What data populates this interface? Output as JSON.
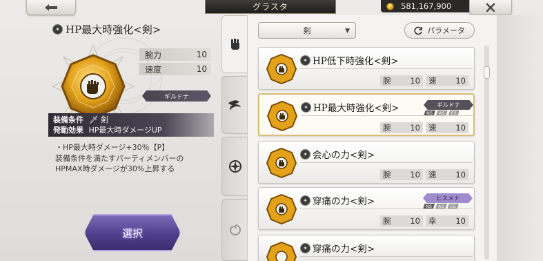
{
  "header": {
    "title": "グラスタ",
    "currency_value": "581,167,900"
  },
  "detail": {
    "title": "HP最大時強化<剣>",
    "stats": [
      {
        "label": "腕力",
        "value": "10"
      },
      {
        "label": "速度",
        "value": "10"
      }
    ],
    "job_tag": "ギルドナ",
    "equip_condition_label": "装備条件",
    "equip_condition_value": "剣",
    "effect_label": "発動効果",
    "effect_value": "HP最大時ダメージUP",
    "description_lines": [
      "・HP最大時ダメージ+30％【P】",
      "装備条件を満たすパーティメンバーの",
      "HPMAX時ダメージが30%上昇する"
    ],
    "select_label": "選択"
  },
  "filter": {
    "dropdown_value": "剣",
    "param_label": "パラメータ"
  },
  "tabs": [
    {
      "icon": "fist-icon",
      "active": true
    },
    {
      "icon": "swirl-icon",
      "active": false
    },
    {
      "icon": "compass-star-icon",
      "active": false
    },
    {
      "icon": "spiral-icon",
      "active": false
    }
  ],
  "list": [
    {
      "name": "HP低下時強化<剣>",
      "stat1_label": "腕",
      "stat1_value": "10",
      "stat2_label": "速",
      "stat2_value": "10",
      "job": "",
      "badges": []
    },
    {
      "name": "HP最大時強化<剣>",
      "stat1_label": "腕",
      "stat1_value": "10",
      "stat2_label": "速",
      "stat2_value": "10",
      "job": "ギルドナ",
      "badges": [
        "NS",
        "AS",
        "ES"
      ]
    },
    {
      "name": "会心の力<剣>",
      "stat1_label": "腕",
      "stat1_value": "10",
      "stat2_label": "速",
      "stat2_value": "10",
      "job": "",
      "badges": []
    },
    {
      "name": "穿痛の力<剣>",
      "stat1_label": "腕",
      "stat1_value": "10",
      "stat2_label": "幸",
      "stat2_value": "10",
      "job": "ヒスメナ",
      "badges": [
        "NS",
        "AS",
        "ES"
      ]
    },
    {
      "name": "穿痛の力<剣>",
      "stat1_label": "",
      "stat1_value": "",
      "stat2_label": "",
      "stat2_value": "",
      "job": "",
      "badges": []
    }
  ],
  "colors": {
    "gem_gold": "#e3a21a",
    "select_purple": "#4e3f8c",
    "selected_border": "#d8bd79"
  }
}
